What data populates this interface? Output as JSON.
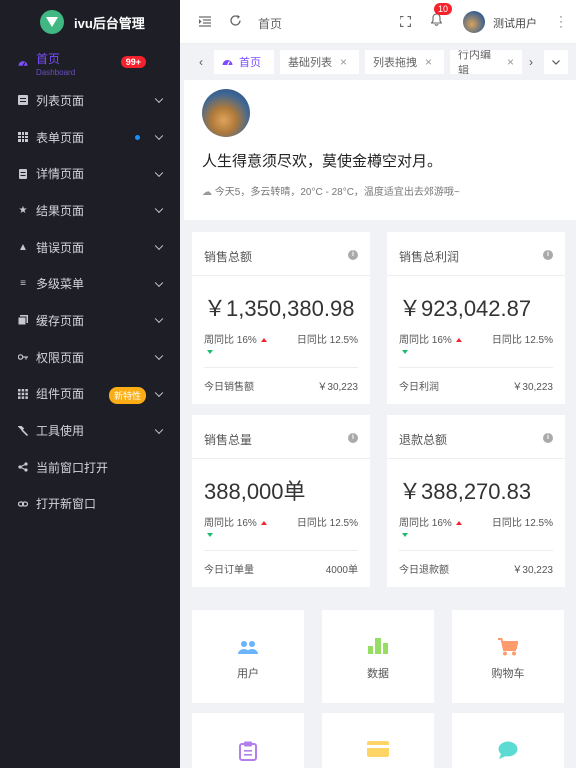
{
  "app": {
    "title": "ivu后台管理"
  },
  "sidebar": {
    "items": [
      {
        "label": "首页",
        "sub": "Dashboard",
        "badge": "99+"
      },
      {
        "label": "列表页面"
      },
      {
        "label": "表单页面"
      },
      {
        "label": "详情页面"
      },
      {
        "label": "结果页面"
      },
      {
        "label": "错误页面"
      },
      {
        "label": "多级菜单"
      },
      {
        "label": "缓存页面"
      },
      {
        "label": "权限页面"
      },
      {
        "label": "组件页面",
        "badge": "新特性"
      },
      {
        "label": "工具使用"
      },
      {
        "label": "当前窗口打开"
      },
      {
        "label": "打开新窗口"
      }
    ]
  },
  "header": {
    "breadcrumb": "首页",
    "notification_count": "10",
    "user_name": "测试用户"
  },
  "tabs": [
    {
      "label": "首页"
    },
    {
      "label": "基础列表"
    },
    {
      "label": "列表拖拽"
    },
    {
      "label": "行内编辑"
    }
  ],
  "welcome": {
    "quote": "人生得意须尽欢，莫使金樽空对月。",
    "weather": "今天5，多云转晴，20°C - 28°C，温度适宜出去郊游哦~"
  },
  "stats": [
    {
      "title": "销售总额",
      "value": "￥1,350,380.98",
      "week_label": "周同比 16%",
      "day_label": "日同比 12.5%",
      "footer_label": "今日销售额",
      "footer_value": "￥30,223"
    },
    {
      "title": "销售总利润",
      "value": "￥923,042.87",
      "week_label": "周同比 16%",
      "day_label": "日同比 12.5%",
      "footer_label": "今日利润",
      "footer_value": "￥30,223"
    },
    {
      "title": "销售总量",
      "value": "388,000单",
      "week_label": "周同比 16%",
      "day_label": "日同比 12.5%",
      "footer_label": "今日订单量",
      "footer_value": "4000单"
    },
    {
      "title": "退款总额",
      "value": "￥388,270.83",
      "week_label": "周同比 16%",
      "day_label": "日同比 12.5%",
      "footer_label": "今日退款额",
      "footer_value": "￥30,223"
    }
  ],
  "quick_links": [
    {
      "label": "用户",
      "icon": "users-icon",
      "color": "#69b4ff"
    },
    {
      "label": "数据",
      "icon": "bar-chart-icon",
      "color": "#95de64"
    },
    {
      "label": "购物车",
      "icon": "cart-icon",
      "color": "#ff9c6e"
    },
    {
      "label": "",
      "icon": "clipboard-icon",
      "color": "#b37feb"
    },
    {
      "label": "",
      "icon": "card-icon",
      "color": "#ffd666"
    },
    {
      "label": "",
      "icon": "chat-icon",
      "color": "#5cdbd3"
    }
  ],
  "colors": {
    "accent": "#7c4dff",
    "sidebar_bg": "#1d1e26",
    "danger": "#f5222d"
  }
}
